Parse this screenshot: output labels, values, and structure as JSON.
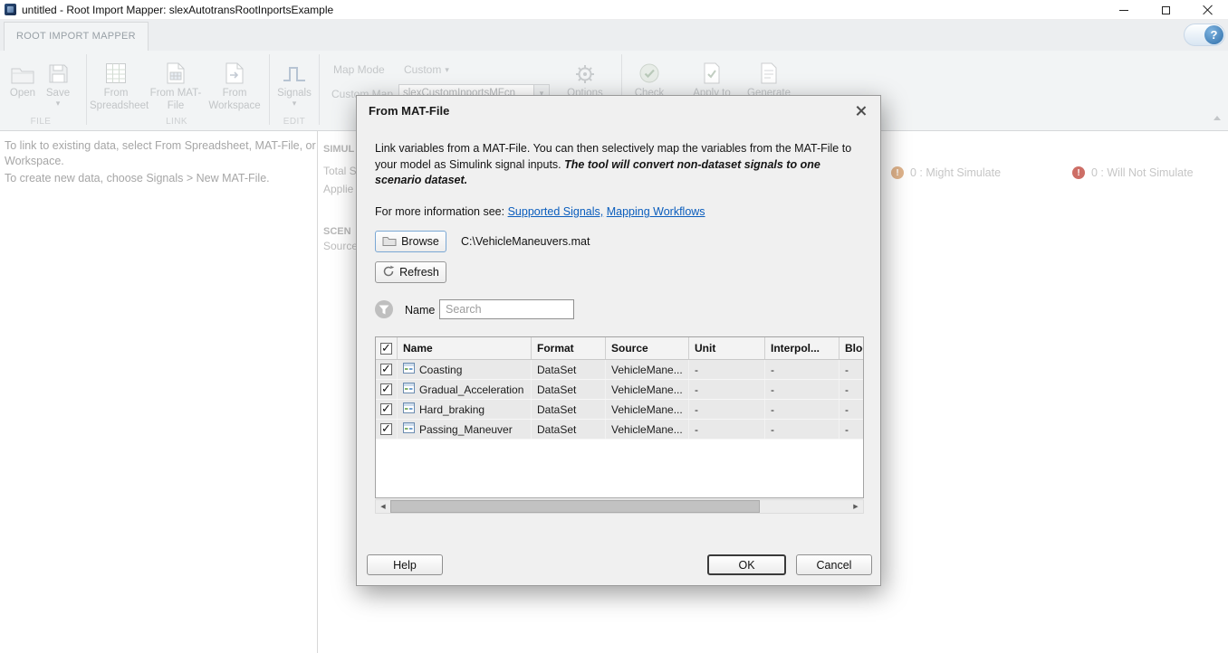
{
  "icons": {
    "dropdown": "▾",
    "help": "?",
    "scroll_left": "◀",
    "scroll_right": "▶"
  },
  "window": {
    "title": "untitled - Root Import Mapper: slexAutotransRootInportsExample"
  },
  "ribbon": {
    "tab_label": "ROOT IMPORT MAPPER",
    "file": {
      "group_label": "FILE",
      "open": "Open",
      "save": "Save"
    },
    "link": {
      "group_label": "LINK",
      "from_spreadsheet": "From Spreadsheet",
      "from_matfile": "From MAT-File",
      "from_workspace": "From Workspace"
    },
    "edit": {
      "group_label": "EDIT",
      "signals": "Signals"
    },
    "map_mode_label": "Map Mode",
    "map_mode_value": "Custom",
    "custom_map_label": "Custom Map",
    "custom_map_value": "slexCustomInportsMFcn",
    "options": "Options",
    "check_map": "Check Map",
    "apply_to": "Apply to",
    "generate": "Generate"
  },
  "workspace": {
    "hint_link": "To link to existing data, select From Spreadsheet, MAT-File, or Workspace.",
    "hint_create": "To create new data, choose Signals > New MAT-File.",
    "section_simulation": "SIMUL",
    "row_total": "Total S",
    "row_applied": "Applie",
    "section_scenario": "SCEN",
    "row_source": "Source",
    "status_might_simulate": "0 : Might Simulate",
    "status_will_not_simulate": "0 : Will Not Simulate",
    "warn_glyph": "!",
    "error_glyph": "!"
  },
  "dialog": {
    "title": "From MAT-File",
    "desc_normal": "Link variables from a MAT-File. You can then selectively map the variables from the MAT-File to your model as Simulink signal inputs. ",
    "desc_emphasis": "The tool will convert non-dataset signals to one scenario dataset.",
    "info_prefix": "For more information see: ",
    "link_supported": "Supported Signals,",
    "link_mapping": "Mapping Workflows",
    "browse": "Browse",
    "file_path": "C:\\VehicleManeuvers.mat",
    "refresh": "Refresh",
    "filter_field_label": "Name",
    "search_placeholder": "Search",
    "table": {
      "headers": {
        "name": "Name",
        "format": "Format",
        "source": "Source",
        "unit": "Unit",
        "interp": "Interpol...",
        "block": "Bloc"
      },
      "rows": [
        {
          "name": "Coasting",
          "format": "DataSet",
          "source": "VehicleMane...",
          "unit": "-",
          "interp": "-",
          "block": "-"
        },
        {
          "name": "Gradual_Acceleration",
          "format": "DataSet",
          "source": "VehicleMane...",
          "unit": "-",
          "interp": "-",
          "block": "-"
        },
        {
          "name": "Hard_braking",
          "format": "DataSet",
          "source": "VehicleMane...",
          "unit": "-",
          "interp": "-",
          "block": "-"
        },
        {
          "name": "Passing_Maneuver",
          "format": "DataSet",
          "source": "VehicleMane...",
          "unit": "-",
          "interp": "-",
          "block": "-"
        }
      ]
    },
    "help": "Help",
    "ok": "OK",
    "cancel": "Cancel"
  }
}
